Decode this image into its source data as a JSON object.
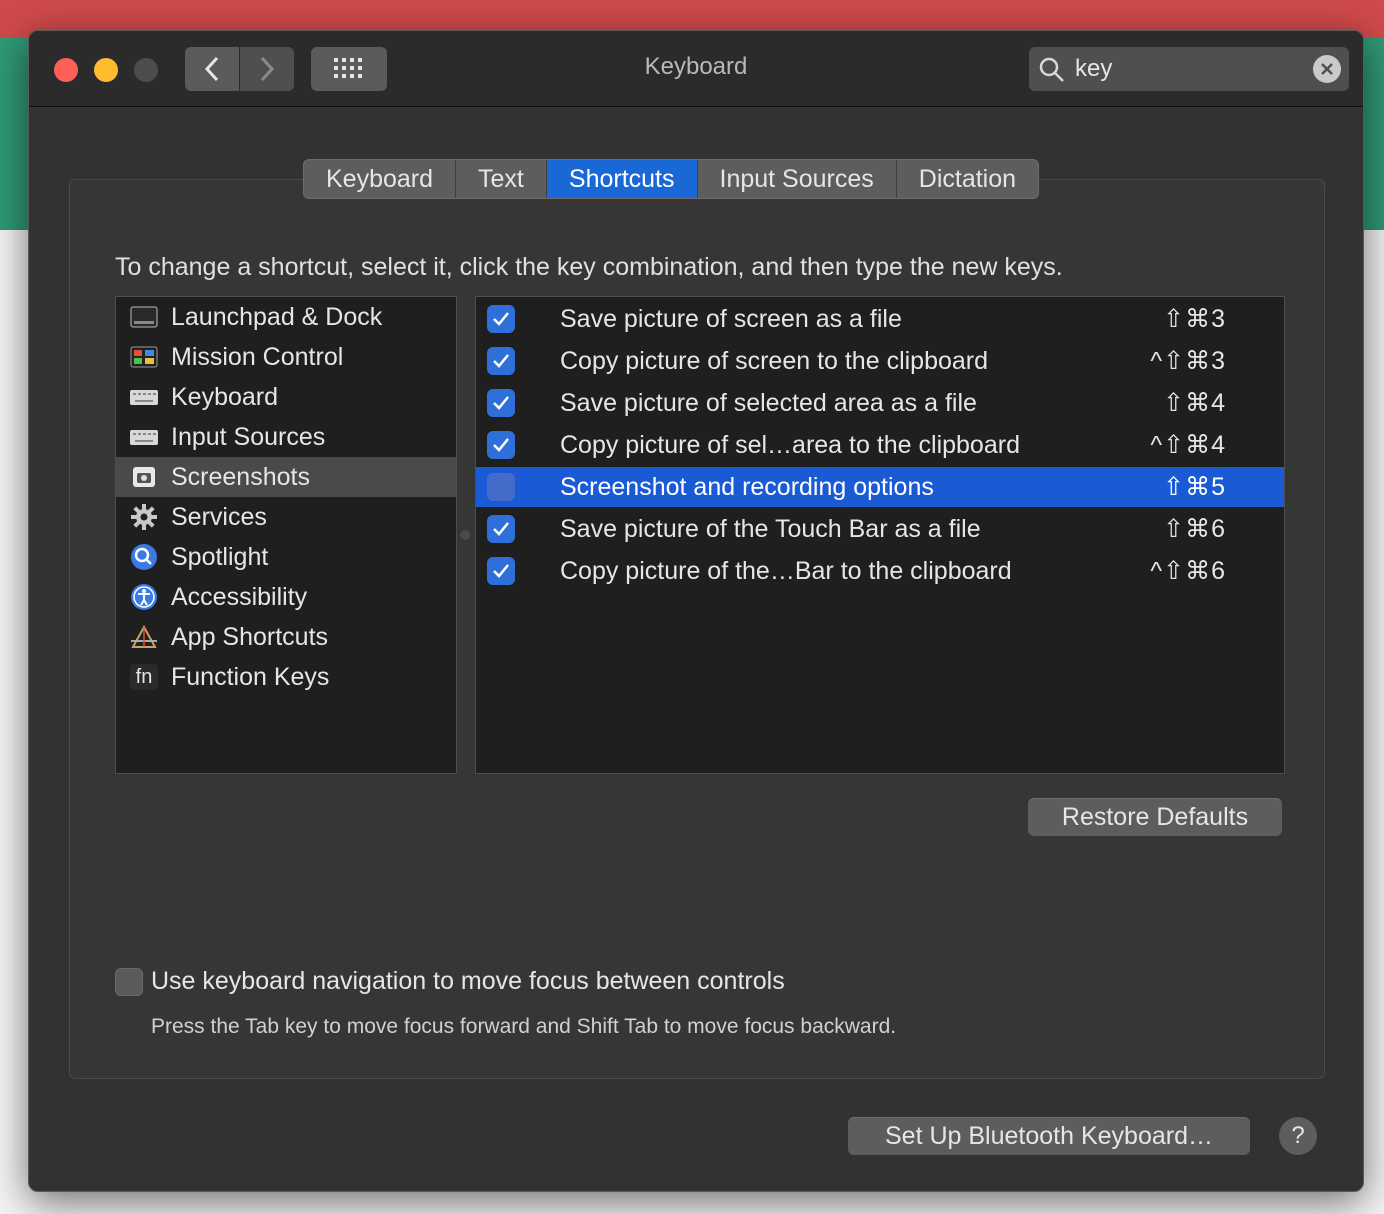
{
  "window": {
    "title": "Keyboard",
    "search_value": "key"
  },
  "tabs": [
    "Keyboard",
    "Text",
    "Shortcuts",
    "Input Sources",
    "Dictation"
  ],
  "active_tab": "Shortcuts",
  "instructions": "To change a shortcut, select it, click the key combination, and then type the new keys.",
  "categories": [
    {
      "label": "Launchpad & Dock",
      "icon": "launchpad-dock-icon"
    },
    {
      "label": "Mission Control",
      "icon": "mission-control-icon"
    },
    {
      "label": "Keyboard",
      "icon": "keyboard-icon"
    },
    {
      "label": "Input Sources",
      "icon": "input-sources-icon"
    },
    {
      "label": "Screenshots",
      "icon": "screenshots-icon",
      "selected": true
    },
    {
      "label": "Services",
      "icon": "gear-icon"
    },
    {
      "label": "Spotlight",
      "icon": "spotlight-icon"
    },
    {
      "label": "Accessibility",
      "icon": "accessibility-icon"
    },
    {
      "label": "App Shortcuts",
      "icon": "app-shortcuts-icon"
    },
    {
      "label": "Function Keys",
      "icon": "fn-key-icon",
      "icon_text": "fn"
    }
  ],
  "shortcuts": [
    {
      "label": "Save picture of screen as a file",
      "keys": "⇧⌘3",
      "checked": true
    },
    {
      "label": "Copy picture of screen to the clipboard",
      "keys": "^⇧⌘3",
      "checked": true
    },
    {
      "label": "Save picture of selected area as a file",
      "keys": "⇧⌘4",
      "checked": true
    },
    {
      "label": "Copy picture of sel…area to the clipboard",
      "keys": "^⇧⌘4",
      "checked": true
    },
    {
      "label": "Screenshot and recording options",
      "keys": "⇧⌘5",
      "checked": false,
      "selected": true
    },
    {
      "label": "Save picture of the Touch Bar as a file",
      "keys": "⇧⌘6",
      "checked": true
    },
    {
      "label": "Copy picture of the…Bar to the clipboard",
      "keys": "^⇧⌘6",
      "checked": true
    }
  ],
  "restore_defaults": "Restore Defaults",
  "keyboard_navigation": {
    "label": "Use keyboard navigation to move focus between controls",
    "help": "Press the Tab key to move focus forward and Shift Tab to move focus backward.",
    "checked": false
  },
  "bluetooth_button": "Set Up Bluetooth Keyboard…",
  "help_button": "?",
  "colors": {
    "accent": "#1a67d6",
    "selection": "#1a5ad4",
    "window_bg": "#323232"
  }
}
